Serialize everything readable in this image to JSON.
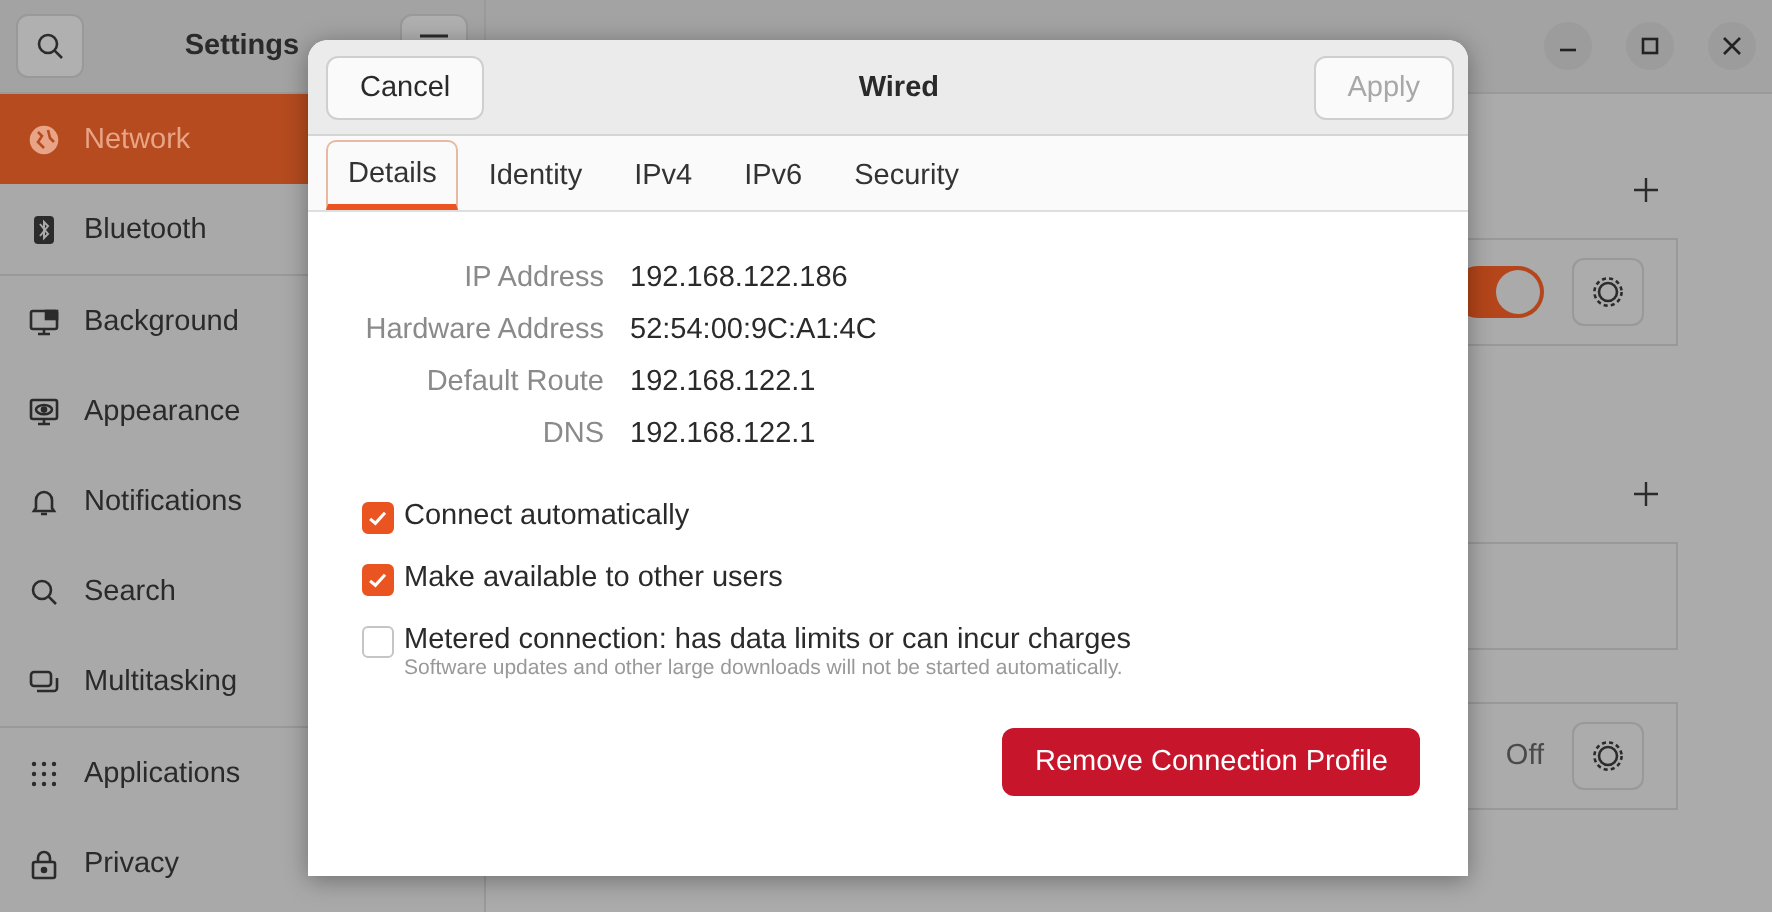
{
  "settings": {
    "title": "Settings",
    "sidebar": {
      "groups": [
        {
          "items": [
            {
              "label": "Network",
              "selected": true
            },
            {
              "label": "Bluetooth",
              "selected": false
            }
          ]
        },
        {
          "items": [
            {
              "label": "Background",
              "selected": false
            },
            {
              "label": "Appearance",
              "selected": false
            },
            {
              "label": "Notifications",
              "selected": false
            },
            {
              "label": "Search",
              "selected": false
            },
            {
              "label": "Multitasking",
              "selected": false
            }
          ]
        },
        {
          "items": [
            {
              "label": "Applications",
              "selected": false
            },
            {
              "label": "Privacy",
              "selected": false
            }
          ]
        }
      ]
    }
  },
  "network_page": {
    "sections": [
      {
        "kind": "toggle",
        "on": true
      },
      {
        "kind": "empty"
      },
      {
        "kind": "status",
        "status": "Off"
      }
    ]
  },
  "dialog": {
    "title": "Wired",
    "cancel": "Cancel",
    "apply": {
      "label": "Apply",
      "disabled": true
    },
    "tabs": [
      {
        "label": "Details",
        "selected": true
      },
      {
        "label": "Identity",
        "selected": false
      },
      {
        "label": "IPv4",
        "selected": false
      },
      {
        "label": "IPv6",
        "selected": false
      },
      {
        "label": "Security",
        "selected": false
      }
    ],
    "details": [
      {
        "label": "IP Address",
        "value": "192.168.122.186"
      },
      {
        "label": "Hardware Address",
        "value": "52:54:00:9C:A1:4C"
      },
      {
        "label": "Default Route",
        "value": "192.168.122.1"
      },
      {
        "label": "DNS",
        "value": "192.168.122.1"
      }
    ],
    "options": [
      {
        "label": "Connect automatically",
        "checked": true
      },
      {
        "label": "Make available to other users",
        "checked": true
      },
      {
        "label": "Metered connection: has data limits or can incur charges",
        "hint": "Software updates and other large downloads will not be started automatically.",
        "checked": false
      }
    ],
    "remove_button": "Remove Connection Profile"
  }
}
